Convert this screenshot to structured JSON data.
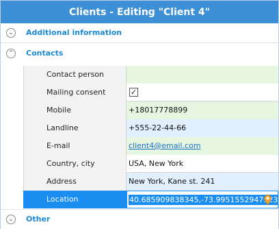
{
  "window": {
    "title": "Clients - Editing \"Client 4\""
  },
  "sections": {
    "additional": {
      "label": "Additional information",
      "icon": "expand-icon"
    },
    "contacts": {
      "label": "Contacts",
      "icon": "collapse-icon"
    },
    "other": {
      "label": "Other",
      "icon": "expand-icon"
    }
  },
  "fields": [
    {
      "label": "Contact person",
      "value": ""
    },
    {
      "label": "Mailing consent",
      "value": "✓"
    },
    {
      "label": "Mobile",
      "value": "+18017778899"
    },
    {
      "label": "Landline",
      "value": "+555-22-44-66"
    },
    {
      "label": "E-mail",
      "value": "client4@email.com"
    },
    {
      "label": "Country, city",
      "value": "USA, New York"
    },
    {
      "label": "Address",
      "value": "New York, Kane st. 241"
    },
    {
      "label": "Location",
      "value": "40.685909838345,-73.9951552947923"
    }
  ],
  "colors": {
    "title_bar": "#3d8fd6",
    "section_label": "#1b8ad6",
    "selected": "#1a8df0",
    "green_cell": "#e6f6e0",
    "blue_cell": "#e2efff"
  }
}
